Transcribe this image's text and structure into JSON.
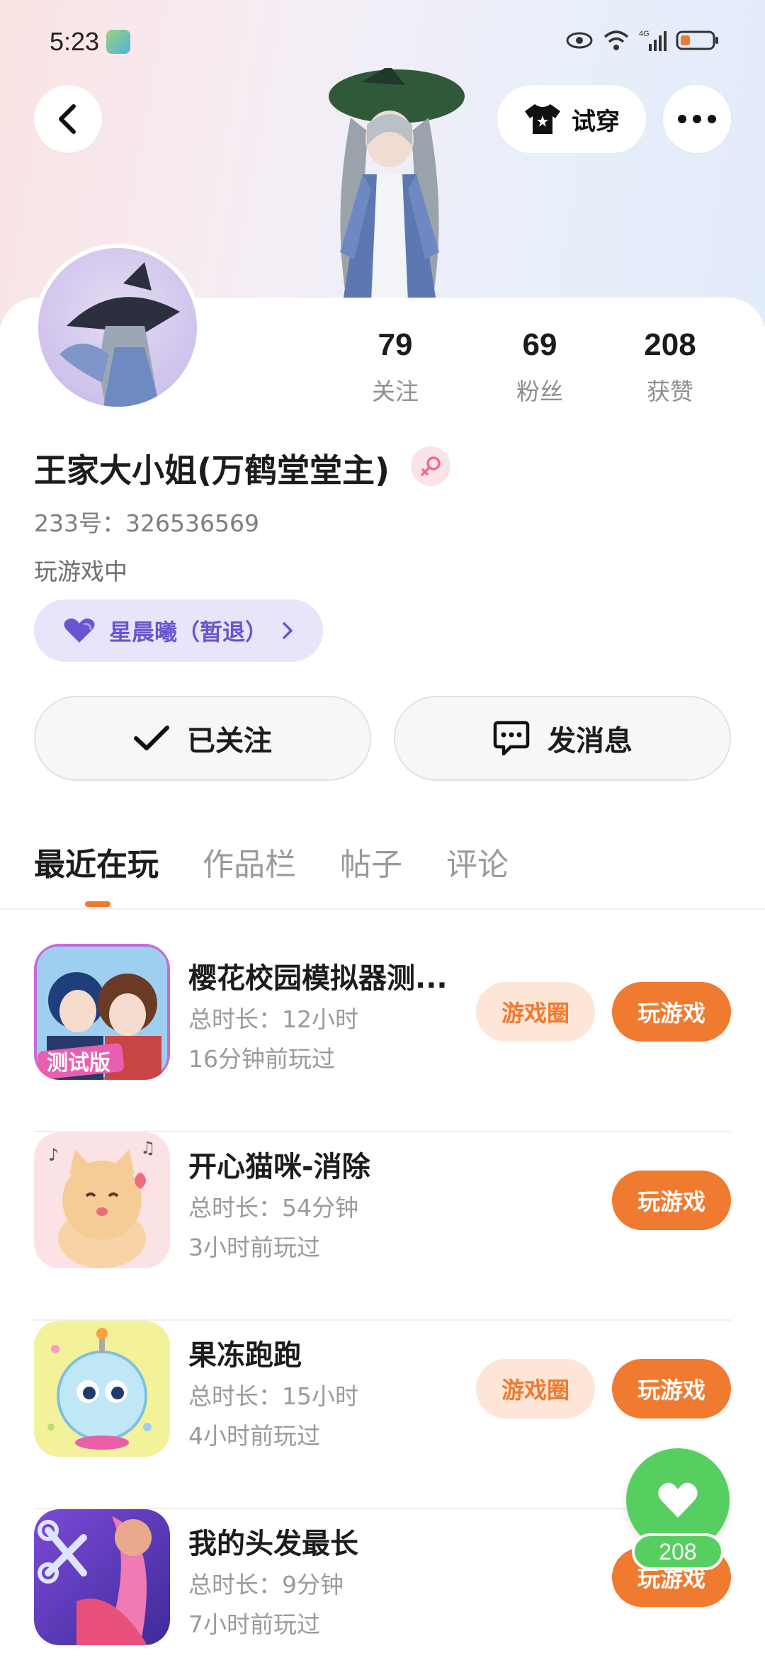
{
  "status_bar": {
    "time": "5:23",
    "network_label": "4G"
  },
  "header": {
    "try_on_label": "试穿"
  },
  "profile": {
    "stats": [
      {
        "value": "79",
        "label": "关注"
      },
      {
        "value": "69",
        "label": "粉丝"
      },
      {
        "value": "208",
        "label": "获赞"
      }
    ],
    "username": "王家大小姐(万鹤堂堂主)",
    "uid": "233号：326536569",
    "status": "玩游戏中",
    "guild": "星晨曦（暂退）",
    "follow_label": "已关注",
    "message_label": "发消息"
  },
  "tabs": [
    "最近在玩",
    "作品栏",
    "帖子",
    "评论"
  ],
  "circle_label": "游戏圈",
  "play_label": "玩游戏",
  "games": [
    {
      "name": "樱花校园模拟器测...",
      "duration": "总时长：12小时",
      "last": "16分钟前玩过",
      "badge": "测试版",
      "has_circle": true
    },
    {
      "name": "开心猫咪-消除",
      "duration": "总时长：54分钟",
      "last": "3小时前玩过",
      "has_circle": false
    },
    {
      "name": "果冻跑跑",
      "duration": "总时长：15小时",
      "last": "4小时前玩过",
      "has_circle": true
    },
    {
      "name": "我的头发最长",
      "duration": "总时长：9分钟",
      "last": "7小时前玩过",
      "has_circle": false
    }
  ],
  "like_fab": {
    "count": "208"
  },
  "colors": {
    "accent": "#f07a2f",
    "like_green": "#57cf60",
    "guild_purple": "#6a55d0"
  }
}
